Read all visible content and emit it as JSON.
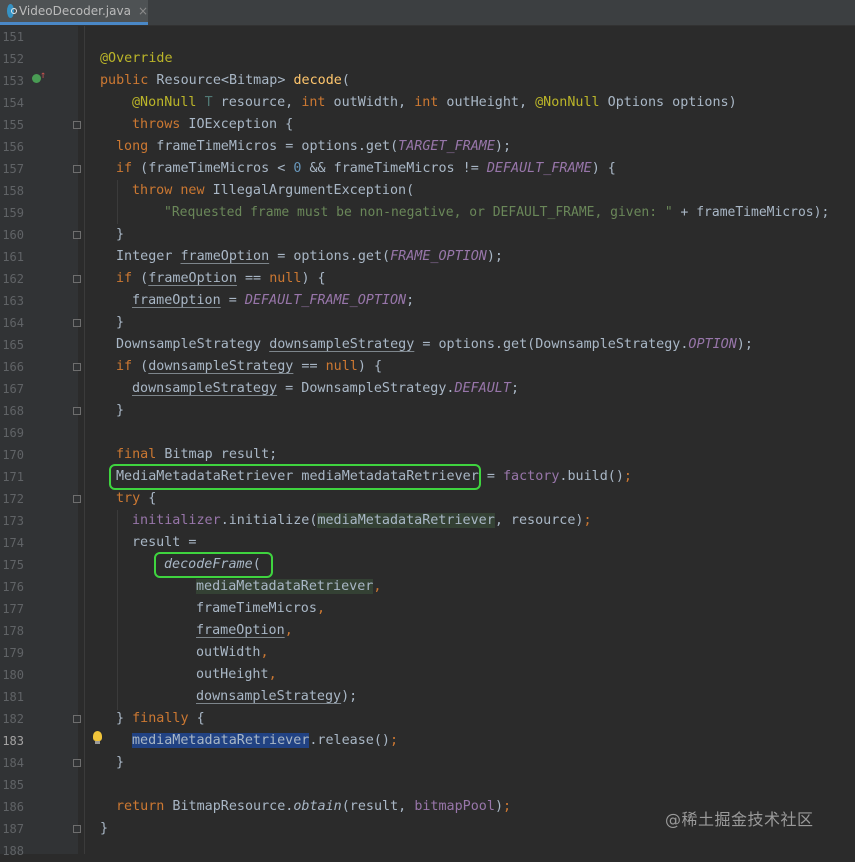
{
  "tab": {
    "label": "VideoDecoder.java",
    "close": "×"
  },
  "line_numbers": [
    "151",
    "152",
    "153",
    "154",
    "155",
    "156",
    "157",
    "158",
    "159",
    "160",
    "161",
    "162",
    "163",
    "164",
    "165",
    "166",
    "167",
    "168",
    "169",
    "170",
    "171",
    "172",
    "173",
    "174",
    "175",
    "176",
    "177",
    "178",
    "179",
    "180",
    "181",
    "182",
    "183",
    "184",
    "185",
    "186",
    "187",
    "188"
  ],
  "current_line": "183",
  "code": {
    "l152": [
      "@Override"
    ],
    "l153": [
      "public",
      " Resource<Bitmap> ",
      "decode",
      "("
    ],
    "l154": [
      "@NonNull",
      " ",
      "T",
      " resource, ",
      "int",
      " outWidth, ",
      "int",
      " outHeight, ",
      "@NonNull",
      " Options options)"
    ],
    "l155": [
      "throws",
      " IOException {"
    ],
    "l156": [
      "long",
      " frameTimeMicros = options.get(",
      "TARGET_FRAME",
      ");"
    ],
    "l157": [
      "if",
      " (frameTimeMicros < ",
      "0",
      " && frameTimeMicros != ",
      "DEFAULT_FRAME",
      ") {"
    ],
    "l158": [
      "throw",
      " ",
      "new",
      " IllegalArgumentException("
    ],
    "l159": [
      "\"Requested frame must be non-negative, or DEFAULT_FRAME, given: \"",
      " + frameTimeMicros);"
    ],
    "l160": [
      "}"
    ],
    "l161": [
      "Integer ",
      "frameOption",
      " = options.get(",
      "FRAME_OPTION",
      ");"
    ],
    "l162": [
      "if",
      " (",
      "frameOption",
      " == ",
      "null",
      ") {"
    ],
    "l163": [
      "frameOption",
      " = ",
      "DEFAULT_FRAME_OPTION",
      ";"
    ],
    "l164": [
      "}"
    ],
    "l165": [
      "DownsampleStrategy ",
      "downsampleStrategy",
      " = options.get(DownsampleStrategy.",
      "OPTION",
      ");"
    ],
    "l166": [
      "if",
      " (",
      "downsampleStrategy",
      " == ",
      "null",
      ") {"
    ],
    "l167": [
      "downsampleStrategy",
      " = DownsampleStrategy.",
      "DEFAULT",
      ";"
    ],
    "l168": [
      "}"
    ],
    "l170": [
      "final",
      " Bitmap result;"
    ],
    "l171": [
      "MediaMetadataRetriever mediaMetadataRetriever",
      " = ",
      "factory",
      ".build()",
      ";"
    ],
    "l172": [
      "try",
      " {"
    ],
    "l173": [
      "initializer",
      ".initialize(",
      "mediaMetadataRetriever",
      ", resource)",
      ";"
    ],
    "l174": [
      "result ="
    ],
    "l175": [
      "decodeFrame",
      "("
    ],
    "l176": [
      "mediaMetadataRetriever",
      ","
    ],
    "l177": [
      "frameTimeMicros",
      ","
    ],
    "l178": [
      "frameOption",
      ","
    ],
    "l179": [
      "outWidth",
      ","
    ],
    "l180": [
      "outHeight",
      ","
    ],
    "l181": [
      "downsampleStrategy",
      ");"
    ],
    "l182": [
      "} ",
      "finally",
      " {"
    ],
    "l183": [
      "mediaMetadataRetriever",
      ".release()",
      ";"
    ],
    "l184": [
      "}"
    ],
    "l186": [
      "return",
      " BitmapResource.",
      "obtain",
      "(result, ",
      "bitmapPool",
      ")",
      ";"
    ],
    "l187": [
      "}"
    ]
  },
  "watermark": "@稀土掘金技术社区",
  "colors": {
    "background": "#2b2b2b",
    "keyword": "#cc7832",
    "annotation": "#bbb529",
    "method": "#ffc66d",
    "number": "#6897bb",
    "constant": "#9876aa",
    "string": "#6a8759",
    "highlight_box": "#3fd43f",
    "selection": "#214283"
  }
}
